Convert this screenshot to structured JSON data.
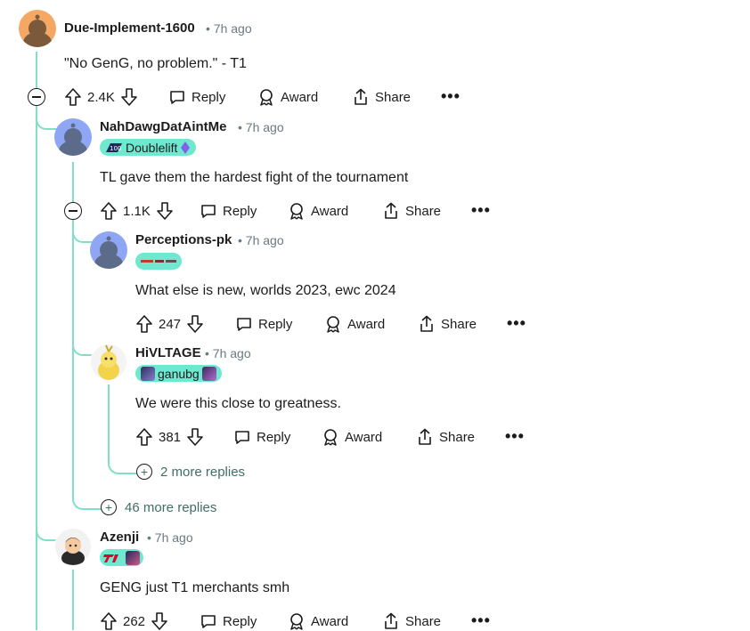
{
  "comments": [
    {
      "username": "Due-Implement-1600",
      "time": "7h ago",
      "text": "\"No GenG, no problem.\" - T1",
      "score": "2.4K"
    },
    {
      "username": "NahDawgDatAintMe",
      "time": "7h ago",
      "flair": "Doublelift",
      "text": "TL gave them the hardest fight of the tournament",
      "score": "1.1K"
    },
    {
      "username": "Perceptions-pk",
      "time": "7h ago",
      "text": "What else is new, worlds 2023, ewc 2024",
      "score": "247"
    },
    {
      "username": "HiVLTAGE",
      "time": "7h ago",
      "flair": "ganubg",
      "text": "We were this close to greatness.",
      "score": "381"
    },
    {
      "username": "Azenji",
      "time": "7h ago",
      "text": "GENG just T1 merchants smh",
      "score": "262"
    }
  ],
  "labels": {
    "reply": "Reply",
    "award": "Award",
    "share": "Share",
    "separator": "•",
    "more": "•••"
  },
  "more_replies": {
    "hivltage": "2 more replies",
    "nahdawg": "46 more replies"
  },
  "colors": {
    "thread_line": "#7fe0c6",
    "flair_bg": "#6fe8d0",
    "meta": "#6b7a80"
  }
}
